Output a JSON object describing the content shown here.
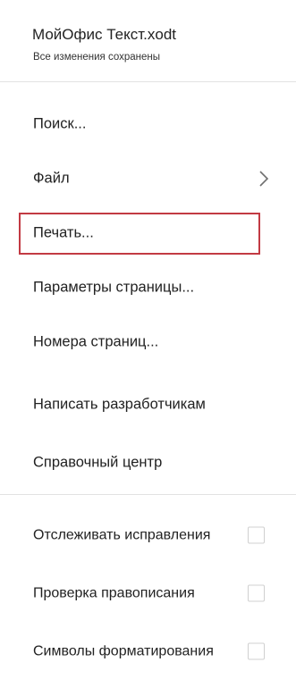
{
  "header": {
    "title": "МойОфис Текст.xodt",
    "status": "Все изменения сохранены"
  },
  "menu": {
    "items": [
      {
        "label": "Поиск..."
      },
      {
        "label": "Файл",
        "has_submenu": true,
        "submenu_icon": "chevron-right-icon"
      },
      {
        "label": "Печать...",
        "focused": true
      },
      {
        "label": "Параметры страницы..."
      },
      {
        "label": "Номера страниц..."
      },
      {
        "label": "Написать разработчикам"
      },
      {
        "label": "Справочный центр"
      }
    ],
    "toggles": [
      {
        "label": "Отслеживать исправления",
        "checked": false
      },
      {
        "label": "Проверка правописания",
        "checked": false
      },
      {
        "label": "Символы форматирования",
        "checked": false
      }
    ]
  },
  "colors": {
    "focus_frame": "#c23a43",
    "divider": "#e2e2e2",
    "text": "#222222",
    "checkbox_border": "#d0d0d0"
  }
}
